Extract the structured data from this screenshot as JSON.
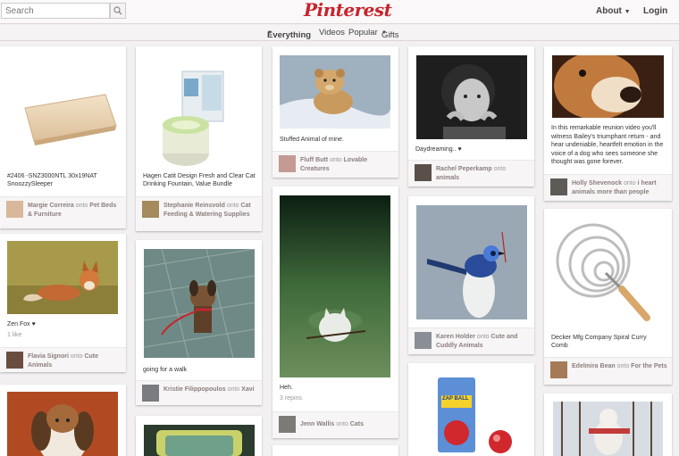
{
  "header": {
    "search_placeholder": "Search",
    "logo": "Pinterest",
    "about": "About",
    "login": "Login"
  },
  "subnav": {
    "everything": "Everything",
    "videos": "Videos",
    "popular": "Popular",
    "gifts": "Gifts"
  },
  "colors": {
    "brand": "#c8232c"
  },
  "pins": {
    "p1": {
      "desc": "#2406 -SNZ3000NTL 30x19NAT SnoozzySleeper",
      "user": "Margie Correira",
      "onto": "onto",
      "board": "Pet Beds & Furniture"
    },
    "p2": {
      "desc": "Zen Fox ♥",
      "meta": "1 like",
      "user": "Flavia Signori",
      "onto": "onto",
      "board": "Cute Animals"
    },
    "p4": {
      "desc": "Hagen Catit Design Fresh and Clear Cat Drinking Fountain, Value Bundle",
      "user": "Stephanie Reinsvold",
      "onto": "onto",
      "board": "Cat Feeding & Watering Supplies"
    },
    "p5": {
      "desc": "going for a walk",
      "user": "Kristie Filippopoulos",
      "onto": "onto",
      "board": "Xavi"
    },
    "p7": {
      "desc": "Stuffed Animal of mine.",
      "user": "Fluff Butt",
      "onto": "onto",
      "board": "Lovable Creatures"
    },
    "p8": {
      "desc": "Heh.",
      "meta": "3 repins",
      "user": "Jenn Wallis",
      "onto": "onto",
      "board": "Cats"
    },
    "p9": {
      "desc": "Daydreaming.. ♥",
      "user": "Rachel Peperkamp",
      "onto": "onto",
      "board": "animals"
    },
    "p10": {
      "user": "Karen Holder",
      "onto": "onto",
      "board": "Cute and Cuddly Animals"
    },
    "p11": {
      "logo_text": "ZAP BALL"
    },
    "p12": {
      "desc": "In this remarkable reunion video you'll witness Bailey's triumphant return - and hear undeniable, heartfelt emotion in the voice of a dog who sees someone she thought was gone forever.",
      "user": "Holly Shevenock",
      "onto": "onto",
      "board": "i heart animals more than people"
    },
    "p13": {
      "desc": "Decker Mfg Company Spiral Curry Comb",
      "user": "Edelmira Bean",
      "onto": "onto",
      "board": "For the Pets"
    }
  }
}
